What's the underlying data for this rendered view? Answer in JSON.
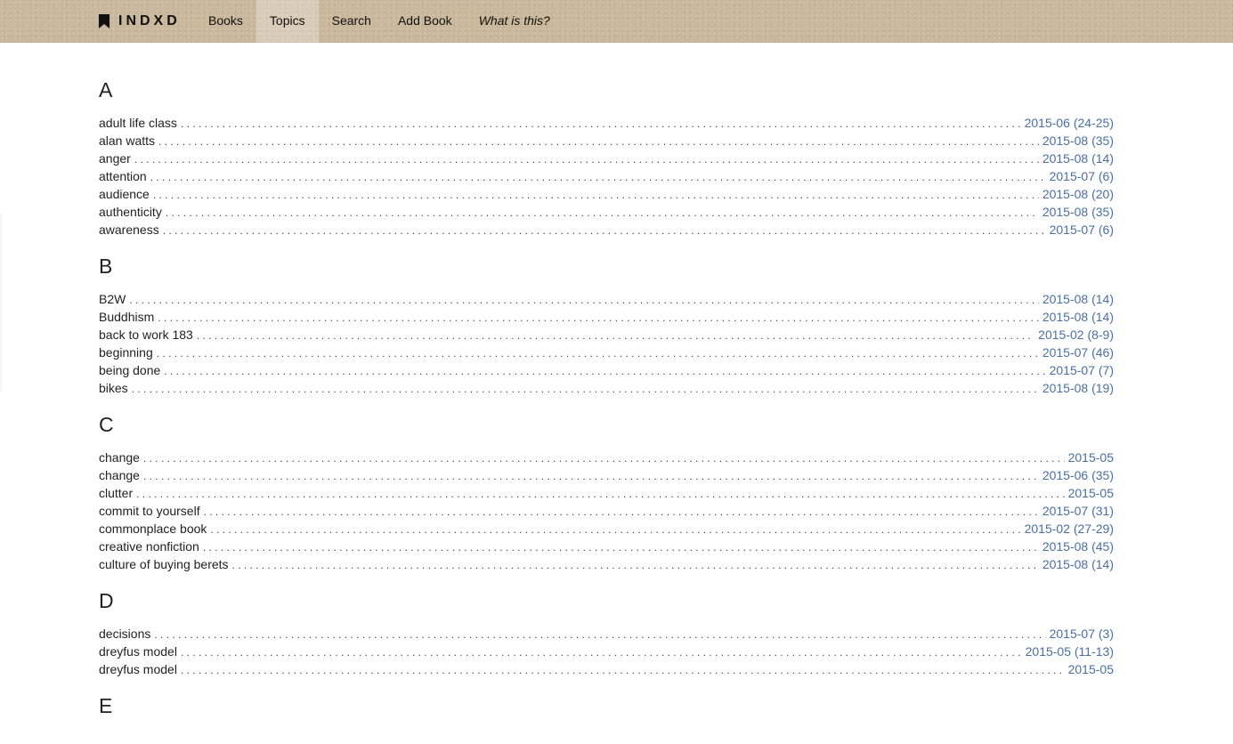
{
  "nav": {
    "brand": "INDXD",
    "links": [
      {
        "label": "Books",
        "active": false,
        "italic": false
      },
      {
        "label": "Topics",
        "active": true,
        "italic": false
      },
      {
        "label": "Search",
        "active": false,
        "italic": false
      },
      {
        "label": "Add Book",
        "active": false,
        "italic": false
      },
      {
        "label": "What is this?",
        "active": false,
        "italic": true
      }
    ]
  },
  "colors": {
    "link": "#4a6fa5",
    "navbar": "#c9b89b"
  },
  "sections": [
    {
      "letter": "A",
      "entries": [
        {
          "term": "adult life class",
          "ref": "2015-06 (24-25)"
        },
        {
          "term": "alan watts",
          "ref": "2015-08 (35)"
        },
        {
          "term": "anger",
          "ref": "2015-08 (14)"
        },
        {
          "term": "attention",
          "ref": "2015-07 (6)"
        },
        {
          "term": "audience",
          "ref": "2015-08 (20)"
        },
        {
          "term": "authenticity",
          "ref": "2015-08 (35)"
        },
        {
          "term": "awareness",
          "ref": "2015-07 (6)"
        }
      ]
    },
    {
      "letter": "B",
      "entries": [
        {
          "term": "B2W",
          "ref": "2015-08 (14)"
        },
        {
          "term": "Buddhism",
          "ref": "2015-08 (14)"
        },
        {
          "term": "back to work 183",
          "ref": "2015-02 (8-9)"
        },
        {
          "term": "beginning",
          "ref": "2015-07 (46)"
        },
        {
          "term": "being done",
          "ref": "2015-07 (7)"
        },
        {
          "term": "bikes",
          "ref": "2015-08 (19)"
        }
      ]
    },
    {
      "letter": "C",
      "entries": [
        {
          "term": "change",
          "ref": "2015-05"
        },
        {
          "term": "change",
          "ref": "2015-06 (35)"
        },
        {
          "term": "clutter",
          "ref": "2015-05"
        },
        {
          "term": "commit to yourself",
          "ref": "2015-07 (31)"
        },
        {
          "term": "commonplace book",
          "ref": "2015-02 (27-29)"
        },
        {
          "term": "creative nonfiction",
          "ref": "2015-08 (45)"
        },
        {
          "term": "culture of buying berets",
          "ref": "2015-08 (14)"
        }
      ]
    },
    {
      "letter": "D",
      "entries": [
        {
          "term": "decisions",
          "ref": "2015-07 (3)"
        },
        {
          "term": "dreyfus model",
          "ref": "2015-05 (11-13)"
        },
        {
          "term": "dreyfus model",
          "ref": "2015-05"
        }
      ]
    },
    {
      "letter": "E",
      "entries": []
    }
  ]
}
